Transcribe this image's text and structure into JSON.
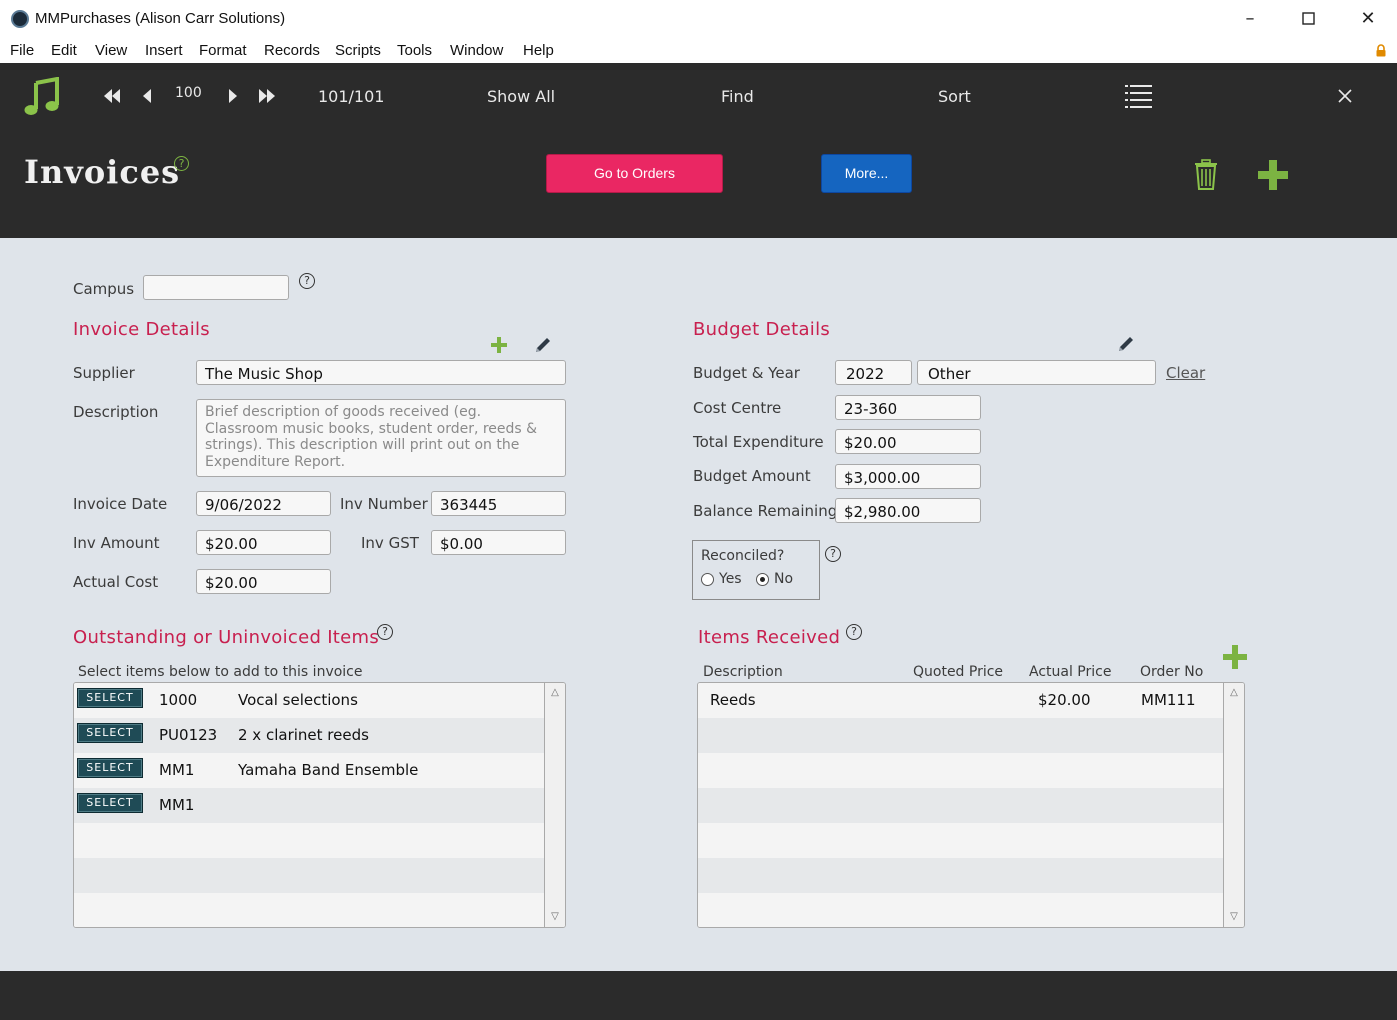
{
  "window": {
    "title": "MMPurchases (Alison Carr Solutions)"
  },
  "menu": [
    "File",
    "Edit",
    "View",
    "Insert",
    "Format",
    "Records",
    "Scripts",
    "Tools",
    "Window",
    "Help"
  ],
  "toolbar": {
    "record_number": "100",
    "record_count": "101/101",
    "show_all": "Show All",
    "find": "Find",
    "sort": "Sort"
  },
  "header": {
    "title": "Invoices",
    "help_glyph": "?",
    "go_to_orders": "Go to Orders",
    "more": "More..."
  },
  "campus": {
    "label": "Campus",
    "value": ""
  },
  "invoice_details": {
    "heading": "Invoice Details",
    "supplier_label": "Supplier",
    "supplier_value": "The Music Shop",
    "description_label": "Description",
    "description_placeholder": "Brief description of goods received (eg. Classroom music books, student order, reeds & strings).  This description will print out on the Expenditure Report.",
    "invoice_date_label": "Invoice Date",
    "invoice_date_value": "9/06/2022",
    "inv_number_label": "Inv Number",
    "inv_number_value": "363445",
    "inv_amount_label": "Inv Amount",
    "inv_amount_value": "$20.00",
    "inv_gst_label": "Inv GST",
    "inv_gst_value": "$0.00",
    "actual_cost_label": "Actual Cost",
    "actual_cost_value": "$20.00"
  },
  "budget_details": {
    "heading": "Budget Details",
    "budget_year_label": "Budget & Year",
    "year_value": "2022",
    "budget_value": "Other",
    "clear": "Clear",
    "cost_centre_label": "Cost Centre",
    "cost_centre_value": "23-360",
    "total_exp_label": "Total Expenditure",
    "total_exp_value": "$20.00",
    "budget_amount_label": "Budget Amount",
    "budget_amount_value": "$3,000.00",
    "balance_label": "Balance Remaining",
    "balance_value": "$2,980.00",
    "reconciled_label": "Reconciled?",
    "reconciled_yes": "Yes",
    "reconciled_no": "No",
    "reconciled_selected": "No"
  },
  "outstanding": {
    "heading": "Outstanding or Uninvoiced Items",
    "subheading": "Select items below to add to this invoice",
    "select_label": "SELECT",
    "rows": [
      {
        "code": "1000",
        "description": "Vocal selections"
      },
      {
        "code": "PU0123",
        "description": "2 x clarinet reeds"
      },
      {
        "code": "MM1",
        "description": "Yamaha Band Ensemble"
      },
      {
        "code": "MM1",
        "description": ""
      }
    ]
  },
  "items_received": {
    "heading": "Items Received",
    "columns": [
      "Description",
      "Quoted Price",
      "Actual Price",
      "Order No"
    ],
    "rows": [
      {
        "description": "Reeds",
        "quoted_price": "",
        "actual_price": "$20.00",
        "order_no": "MM111"
      }
    ]
  },
  "colors": {
    "accent_pink": "#ea2763",
    "accent_blue": "#1565c0",
    "section_heading": "#c8204f",
    "green_icon": "#7cb342"
  }
}
